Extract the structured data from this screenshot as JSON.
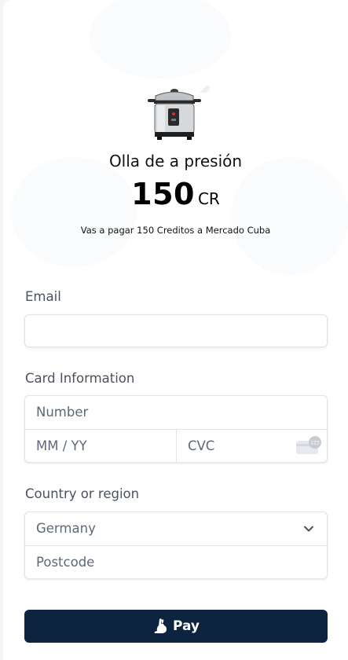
{
  "product": {
    "title": "Olla de a presión",
    "price": "150",
    "unit": "CR",
    "note": "Vas a pagar 150 Creditos a Mercado Cuba",
    "image_icon": "pressure-cooker-icon"
  },
  "form": {
    "email_label": "Email",
    "email_value": "",
    "card_label": "Card Information",
    "number_placeholder": "Number",
    "expiry_placeholder": "MM / YY",
    "cvc_placeholder": "CVC",
    "cvc_badge": "123",
    "country_label": "Country or region",
    "country_value": "Germany",
    "postcode_placeholder": "Postcode"
  },
  "pay_button": {
    "label": "Pay",
    "icon": "rabbit-icon",
    "color": "#0d2440"
  }
}
